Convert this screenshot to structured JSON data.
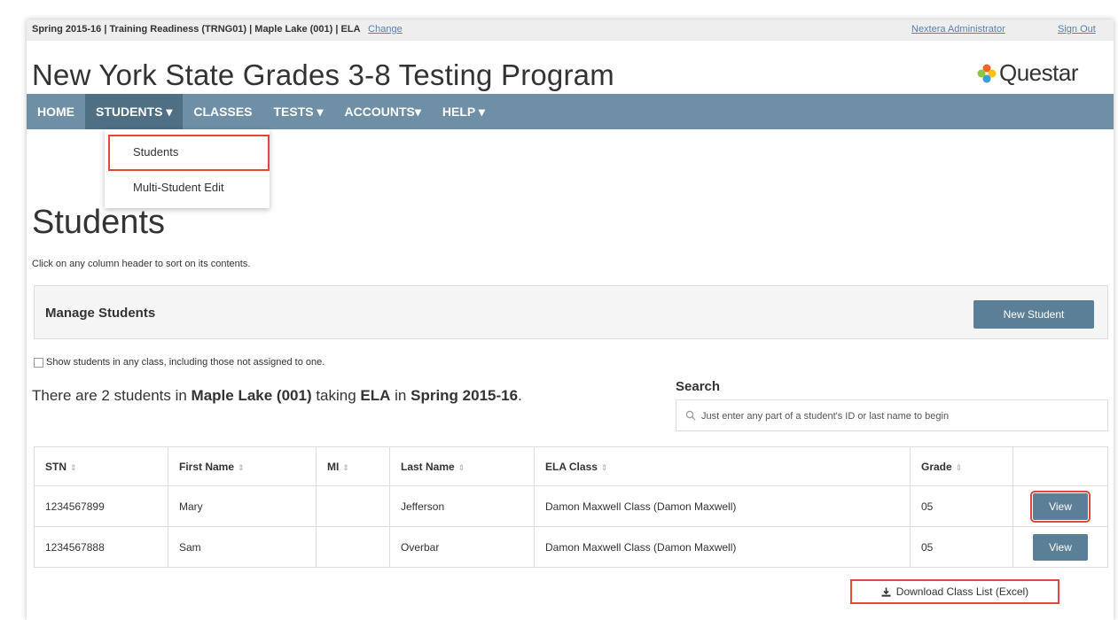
{
  "topbar": {
    "context": "Spring 2015-16  | Training Readiness (TRNG01)  | Maple Lake (001)  | ELA",
    "change_link": "Change",
    "admin_link": "Nextera Administrator",
    "signout_link": "Sign Out"
  },
  "header": {
    "title": "New York State Grades 3-8 Testing Program",
    "logo_text": "Questar"
  },
  "nav": {
    "items": [
      {
        "label": "HOME"
      },
      {
        "label": "STUDENTS ▾",
        "active": true
      },
      {
        "label": "CLASSES"
      },
      {
        "label": "TESTS ▾"
      },
      {
        "label": "ACCOUNTS▾"
      },
      {
        "label": "HELP ▾"
      }
    ],
    "dropdown": [
      "Students",
      "Multi-Student Edit"
    ]
  },
  "page": {
    "title": "Students",
    "hint": "Click on any column header to sort on its contents."
  },
  "manage": {
    "title": "Manage Students",
    "new_button": "New Student"
  },
  "filter": {
    "checkbox_label": "Show students in any class, including those not assigned to one."
  },
  "summary": {
    "prefix": "There are 2 students in ",
    "school": "Maple Lake (001)",
    "mid": " taking ",
    "subject": "ELA",
    "mid2": " in ",
    "term": "Spring 2015-16",
    "suffix": "."
  },
  "search": {
    "label": "Search",
    "placeholder": "Just enter any part of a student's ID or last name to begin"
  },
  "table": {
    "headers": [
      "STN",
      "First Name",
      "MI",
      "Last Name",
      "ELA Class",
      "Grade"
    ],
    "rows": [
      {
        "stn": "1234567899",
        "first": "Mary",
        "mi": "",
        "last": "Jefferson",
        "class": "Damon Maxwell Class (Damon Maxwell)",
        "grade": "05",
        "action": "View"
      },
      {
        "stn": "1234567888",
        "first": "Sam",
        "mi": "",
        "last": "Overbar",
        "class": "Damon Maxwell Class (Damon Maxwell)",
        "grade": "05",
        "action": "View"
      }
    ]
  },
  "download": {
    "label": "Download Class List (Excel)"
  },
  "colors": {
    "nav_bg": "#6e8fa5",
    "nav_active": "#4f6f85",
    "button": "#5a7f96",
    "highlight": "#e2463c",
    "link": "#5b7fb0"
  },
  "icons": {
    "logo": "questar-logo",
    "search": "search-icon",
    "download": "download-icon",
    "sort": "sort-icon"
  }
}
